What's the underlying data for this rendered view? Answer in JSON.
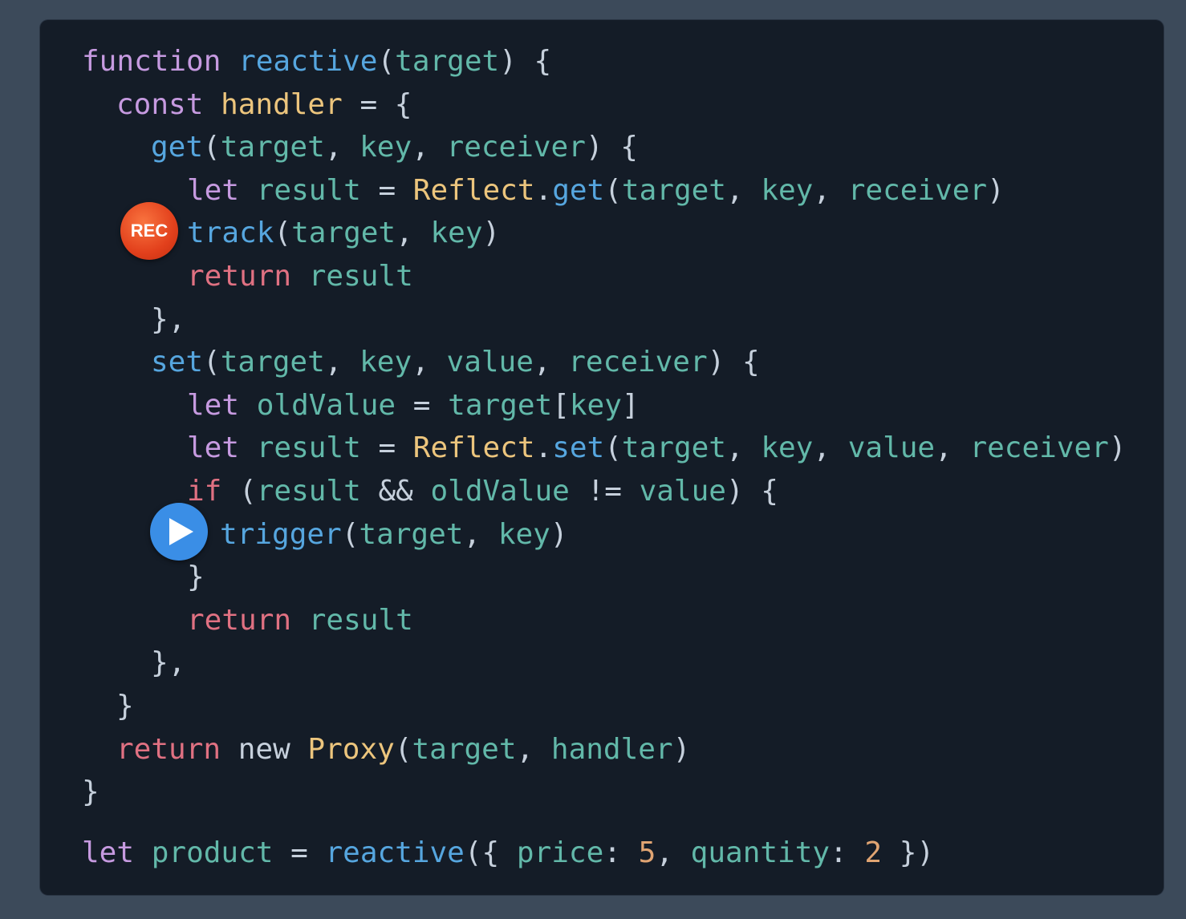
{
  "code_lines": [
    {
      "indent": "0",
      "tokens": [
        [
          "kw",
          "function"
        ],
        [
          "pn",
          " "
        ],
        [
          "fn",
          "reactive"
        ],
        [
          "pn",
          "("
        ],
        [
          "par",
          "target"
        ],
        [
          "pn",
          ") {"
        ]
      ]
    },
    {
      "indent": "i1",
      "tokens": [
        [
          "kw",
          "const"
        ],
        [
          "pn",
          " "
        ],
        [
          "cls",
          "handler"
        ],
        [
          "pn",
          " = {"
        ]
      ]
    },
    {
      "indent": "i2",
      "tokens": [
        [
          "fn",
          "get"
        ],
        [
          "pn",
          "("
        ],
        [
          "par",
          "target"
        ],
        [
          "pn",
          ", "
        ],
        [
          "par",
          "key"
        ],
        [
          "pn",
          ", "
        ],
        [
          "par",
          "receiver"
        ],
        [
          "pn",
          ") {"
        ]
      ]
    },
    {
      "indent": "i3",
      "tokens": [
        [
          "kw",
          "let"
        ],
        [
          "pn",
          " "
        ],
        [
          "par",
          "result"
        ],
        [
          "pn",
          " = "
        ],
        [
          "cls",
          "Reflect"
        ],
        [
          "pn",
          "."
        ],
        [
          "fn",
          "get"
        ],
        [
          "pn",
          "("
        ],
        [
          "par",
          "target"
        ],
        [
          "pn",
          ", "
        ],
        [
          "par",
          "key"
        ],
        [
          "pn",
          ", "
        ],
        [
          "par",
          "receiver"
        ],
        [
          "pn",
          ")"
        ]
      ]
    },
    {
      "indent": "i3",
      "tokens": [
        [
          "fn",
          "track"
        ],
        [
          "pn",
          "("
        ],
        [
          "par",
          "target"
        ],
        [
          "pn",
          ", "
        ],
        [
          "par",
          "key"
        ],
        [
          "pn",
          ")"
        ]
      ]
    },
    {
      "indent": "i3",
      "tokens": [
        [
          "ret",
          "return"
        ],
        [
          "pn",
          " "
        ],
        [
          "par",
          "result"
        ]
      ]
    },
    {
      "indent": "i2",
      "tokens": [
        [
          "pn",
          "},"
        ]
      ]
    },
    {
      "indent": "i2",
      "tokens": [
        [
          "fn",
          "set"
        ],
        [
          "pn",
          "("
        ],
        [
          "par",
          "target"
        ],
        [
          "pn",
          ", "
        ],
        [
          "par",
          "key"
        ],
        [
          "pn",
          ", "
        ],
        [
          "par",
          "value"
        ],
        [
          "pn",
          ", "
        ],
        [
          "par",
          "receiver"
        ],
        [
          "pn",
          ") {"
        ]
      ]
    },
    {
      "indent": "i3",
      "tokens": [
        [
          "kw",
          "let"
        ],
        [
          "pn",
          " "
        ],
        [
          "par",
          "oldValue"
        ],
        [
          "pn",
          " = "
        ],
        [
          "par",
          "target"
        ],
        [
          "pn",
          "["
        ],
        [
          "par",
          "key"
        ],
        [
          "pn",
          "]"
        ]
      ]
    },
    {
      "indent": "i3",
      "tokens": [
        [
          "kw",
          "let"
        ],
        [
          "pn",
          " "
        ],
        [
          "par",
          "result"
        ],
        [
          "pn",
          " = "
        ],
        [
          "cls",
          "Reflect"
        ],
        [
          "pn",
          "."
        ],
        [
          "fn",
          "set"
        ],
        [
          "pn",
          "("
        ],
        [
          "par",
          "target"
        ],
        [
          "pn",
          ", "
        ],
        [
          "par",
          "key"
        ],
        [
          "pn",
          ", "
        ],
        [
          "par",
          "value"
        ],
        [
          "pn",
          ", "
        ],
        [
          "par",
          "receiver"
        ],
        [
          "pn",
          ")"
        ]
      ]
    },
    {
      "indent": "i3",
      "tokens": [
        [
          "ret",
          "if"
        ],
        [
          "pn",
          " ("
        ],
        [
          "par",
          "result"
        ],
        [
          "pn",
          " && "
        ],
        [
          "par",
          "oldValue"
        ],
        [
          "pn",
          " != "
        ],
        [
          "par",
          "value"
        ],
        [
          "pn",
          ") {"
        ]
      ]
    },
    {
      "indent": "i3b",
      "tokens": [
        [
          "fn",
          "trigger"
        ],
        [
          "pn",
          "("
        ],
        [
          "par",
          "target"
        ],
        [
          "pn",
          ", "
        ],
        [
          "par",
          "key"
        ],
        [
          "pn",
          ")"
        ]
      ]
    },
    {
      "indent": "i3",
      "tokens": [
        [
          "pn",
          "}"
        ]
      ]
    },
    {
      "indent": "i3",
      "tokens": [
        [
          "ret",
          "return"
        ],
        [
          "pn",
          " "
        ],
        [
          "par",
          "result"
        ]
      ]
    },
    {
      "indent": "i2",
      "tokens": [
        [
          "pn",
          "},"
        ]
      ]
    },
    {
      "indent": "i1",
      "tokens": [
        [
          "pn",
          "}"
        ]
      ]
    },
    {
      "indent": "i1",
      "tokens": [
        [
          "ret",
          "return"
        ],
        [
          "pn",
          " new "
        ],
        [
          "cls",
          "Proxy"
        ],
        [
          "pn",
          "("
        ],
        [
          "par",
          "target"
        ],
        [
          "pn",
          ", "
        ],
        [
          "par",
          "handler"
        ],
        [
          "pn",
          ")"
        ]
      ]
    },
    {
      "indent": "0",
      "tokens": [
        [
          "pn",
          "}"
        ]
      ]
    },
    {
      "indent": "0",
      "gap": true,
      "tokens": [
        [
          "kw",
          "let"
        ],
        [
          "pn",
          " "
        ],
        [
          "par",
          "product"
        ],
        [
          "pn",
          " = "
        ],
        [
          "fn",
          "reactive"
        ],
        [
          "pn",
          "({ "
        ],
        [
          "par",
          "price"
        ],
        [
          "pn",
          ": "
        ],
        [
          "num",
          "5"
        ],
        [
          "pn",
          ", "
        ],
        [
          "par",
          "quantity"
        ],
        [
          "pn",
          ": "
        ],
        [
          "num",
          "2"
        ],
        [
          "pn",
          " })"
        ]
      ]
    }
  ],
  "badges": {
    "rec_label": "REC",
    "play_icon": "play-icon"
  },
  "colors": {
    "background": "#3c4a5a",
    "panel": "#141c27",
    "rec_badge": "#e2401c",
    "play_badge": "#3a8ee6"
  }
}
